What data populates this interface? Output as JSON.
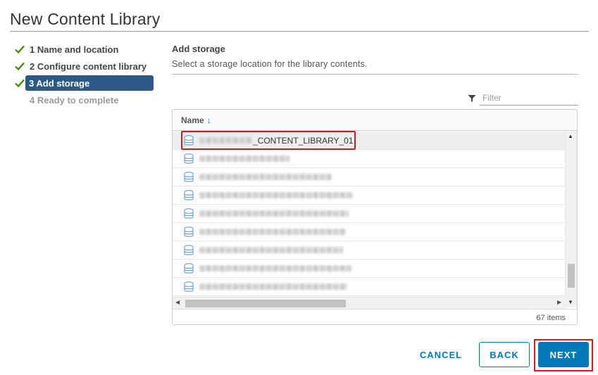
{
  "dialog": {
    "title": "New Content Library"
  },
  "steps": [
    {
      "label": "1 Name and location",
      "status": "done"
    },
    {
      "label": "2 Configure content library",
      "status": "done"
    },
    {
      "label": "3 Add storage",
      "status": "active"
    },
    {
      "label": "4 Ready to complete",
      "status": "pending"
    }
  ],
  "section": {
    "title": "Add storage",
    "subtitle": "Select a storage location for the library contents."
  },
  "filter": {
    "placeholder": "Filter",
    "value": ""
  },
  "grid": {
    "column_name": "Name",
    "sort_icon": "↓",
    "rows": [
      {
        "name_visible": "_CONTENT_LIBRARY_01",
        "blurred_prefix": true,
        "selected": true
      },
      {
        "name_visible": "",
        "blurred_prefix": true
      },
      {
        "name_visible": "",
        "blurred_prefix": true
      },
      {
        "name_visible": "",
        "blurred_prefix": true
      },
      {
        "name_visible": "",
        "blurred_prefix": true
      },
      {
        "name_visible": "",
        "blurred_prefix": true
      },
      {
        "name_visible": "",
        "blurred_prefix": true
      },
      {
        "name_visible": "",
        "blurred_prefix": true
      },
      {
        "name_visible": "",
        "blurred_prefix": true
      }
    ],
    "item_count": "67 items"
  },
  "buttons": {
    "cancel": "CANCEL",
    "back": "BACK",
    "next": "NEXT"
  },
  "colors": {
    "accent": "#0079b8",
    "active_step": "#2b5a86",
    "check": "#3c8500",
    "highlight": "#d11a1a"
  },
  "icons": {
    "step_done": "check-icon",
    "filter": "filter-icon",
    "row": "datastore-icon"
  }
}
